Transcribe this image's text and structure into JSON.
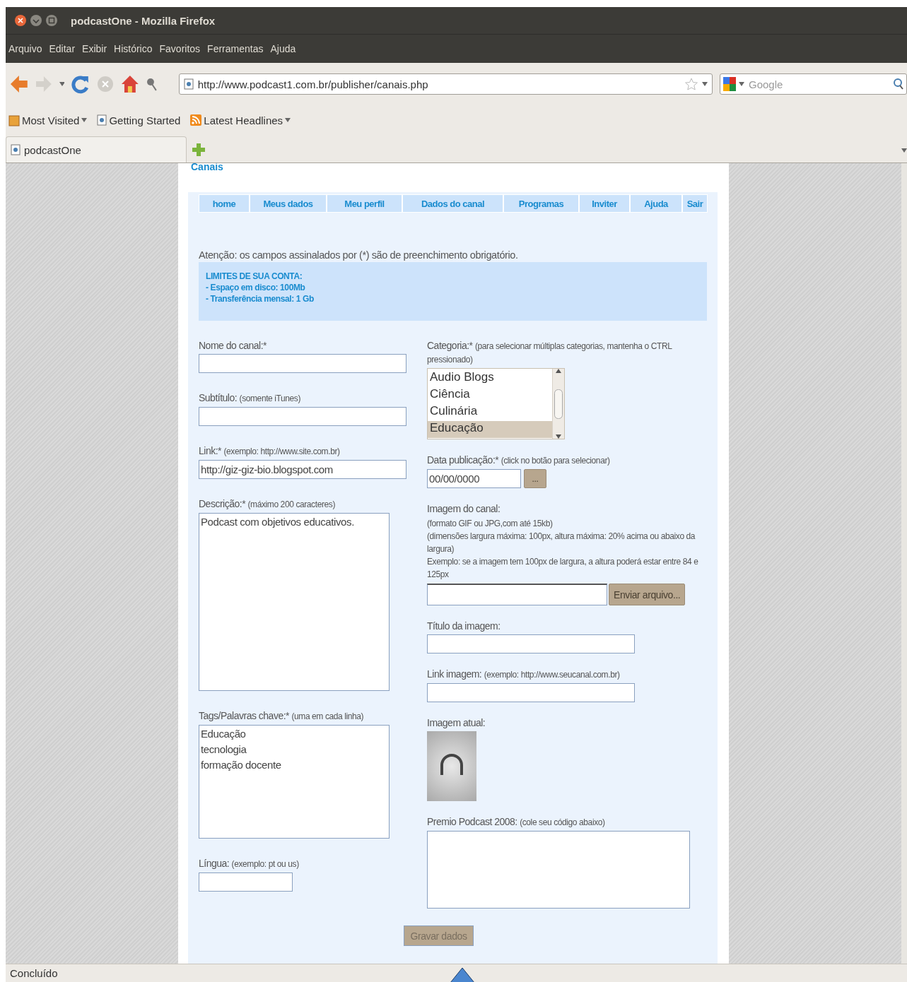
{
  "window": {
    "title": "podcastOne - Mozilla Firefox"
  },
  "menu": [
    "Arquivo",
    "Editar",
    "Exibir",
    "Histórico",
    "Favoritos",
    "Ferramentas",
    "Ajuda"
  ],
  "address": {
    "url": "http://www.podcast1.com.br/publisher/canais.php"
  },
  "search": {
    "placeholder": "Google"
  },
  "bookmarks": [
    {
      "label": "Most Visited",
      "kind": "folder",
      "dropdown": true
    },
    {
      "label": "Getting Started",
      "kind": "page",
      "dropdown": false
    },
    {
      "label": "Latest Headlines",
      "kind": "feed",
      "dropdown": true
    }
  ],
  "tabs": [
    {
      "label": "podcastOne",
      "selected": true
    }
  ],
  "page": {
    "heading": "Canais",
    "nav": [
      "home",
      "Meus dados",
      "Meu perfil",
      "Dados do canal",
      "Programas",
      "Inviter",
      "Ajuda",
      "Sair"
    ],
    "notice": "Atenção: os campos assinalados por (*) são de preenchimento obrigatório.",
    "limits": {
      "title": "LIMITES DE SUA CONTA:",
      "lines": [
        "- Espaço em disco: 100Mb",
        "- Transferência mensal: 1 Gb"
      ]
    },
    "left": [
      {
        "kind": "input",
        "label": "Nome do canal:*"
      },
      {
        "kind": "input",
        "label": "Subtítulo:",
        "hint": "(somente iTunes)"
      },
      {
        "kind": "input",
        "label": "Link:*",
        "hint": "(exemplo: http://www.site.com.br)",
        "value": "http://giz-giz-bio.blogspot.com"
      },
      {
        "kind": "textarea",
        "label": "Descrição:*",
        "hint": "(máximo 200 caracteres)",
        "lines": [
          "Podcast com objetivos educativos."
        ]
      },
      {
        "kind": "textarea",
        "label": "Tags/Palavras chave:*",
        "hint": "(uma em cada linha)",
        "lines": [
          "Educação",
          "tecnologia",
          "formação docente"
        ]
      },
      {
        "kind": "short",
        "label": "Língua:",
        "hint": "(exemplo: pt ou us)"
      }
    ],
    "right": [
      {
        "kind": "listbox",
        "label": "Categoria:*",
        "hint": "(para selecionar múltiplas categorias, mantenha o CTRL pressionado)",
        "options": [
          {
            "label": "Audio Blogs",
            "selected": false
          },
          {
            "label": "Ciência",
            "selected": false
          },
          {
            "label": "Culinária",
            "selected": false
          },
          {
            "label": "Educação",
            "selected": true
          }
        ]
      },
      {
        "kind": "date",
        "label": "Data publicação:*",
        "hint": "(click no botão para selecionar)",
        "value": "00/00/0000",
        "button": "..."
      },
      {
        "kind": "upload",
        "label": "Imagem do canal:",
        "notes": [
          "(formato GIF ou JPG,com até 15kb)",
          "(dimensões largura máxima: 100px, altura máxima: 20% acima ou abaixo da largura)",
          "Exemplo: se a imagem tem 100px de largura, a altura poderá estar entre 84 e 125px"
        ],
        "button": "Enviar arquivo..."
      },
      {
        "kind": "input",
        "label": "Título da imagem:"
      },
      {
        "kind": "input",
        "label": "Link imagem:",
        "hint": "(exemplo: http://www.seucanal.com.br)"
      },
      {
        "kind": "image",
        "label": "Imagem atual:"
      },
      {
        "kind": "textarea",
        "label": "Premio Podcast 2008:",
        "hint": "(cole seu código abaixo)"
      }
    ],
    "submit": "Gravar dados"
  },
  "status": "Concluído"
}
